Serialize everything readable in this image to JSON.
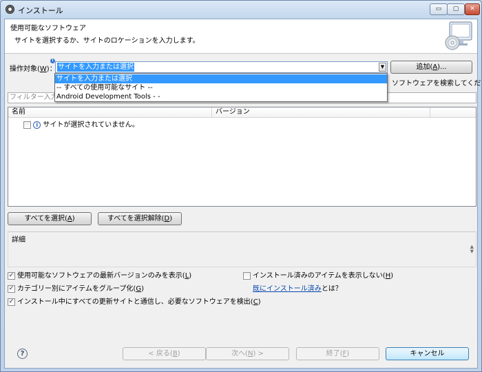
{
  "window": {
    "title": "インストール",
    "controls": {
      "minimize": "▭",
      "maximize": "▢",
      "close": "✕"
    }
  },
  "header": {
    "title": "使用可能なソフトウェア",
    "description": "サイトを選択するか、サイトのロケーションを入力します。",
    "icon": "monitor-cd-icon"
  },
  "work_with": {
    "label": "操作対象(",
    "mnemonic": "W",
    "label_end": ")：",
    "value": "サイトを入力または選択",
    "add_button": {
      "text": "追加(",
      "mnemonic": "A",
      "end": ")..."
    },
    "hint_partial": "ソフトウェアを検索してください。",
    "dropdown_options": [
      "サイトを入力または選択",
      "-- すべての使用可能なサイト --",
      "Android Development Tools -  -"
    ]
  },
  "filter": {
    "placeholder": "フィルター入力"
  },
  "table": {
    "columns": [
      "名前",
      "バージョン"
    ],
    "empty_message": "サイトが選択されていません。"
  },
  "select_all": {
    "text": "すべてを選択(",
    "mnemonic": "A",
    "end": ")"
  },
  "deselect_all": {
    "text": "すべてを選択解除(",
    "mnemonic": "D",
    "end": ")"
  },
  "details": {
    "label": "詳細"
  },
  "options": {
    "latest_only": {
      "text": "使用可能なソフトウェアの最新バージョンのみを表示(",
      "mnemonic": "L",
      "end": ")",
      "checked": true
    },
    "group_by_category": {
      "text": "カテゴリー別にアイテムをグループ化(",
      "mnemonic": "G",
      "end": ")",
      "checked": true
    },
    "contact_sites": {
      "text": "インストール中にすべての更新サイトと通信し、必要なソフトウェアを検出(",
      "mnemonic": "C",
      "end": ")",
      "checked": true
    },
    "hide_installed": {
      "text": "インストール済みのアイテムを表示しない(",
      "mnemonic": "H",
      "end": ")",
      "checked": false
    },
    "already_installed": {
      "link": "既にインストール済み",
      "suffix": "とは？"
    }
  },
  "footer": {
    "back": {
      "text": "< 戻る(",
      "mnemonic": "B",
      "end": ")"
    },
    "next": {
      "text": "次へ(",
      "mnemonic": "N",
      "end": ") >"
    },
    "finish": {
      "text": "終了(",
      "mnemonic": "F",
      "end": ")"
    },
    "cancel": "キャンセル",
    "help_icon": "?"
  },
  "checkbox_mark": "✓",
  "info_mark": "i"
}
